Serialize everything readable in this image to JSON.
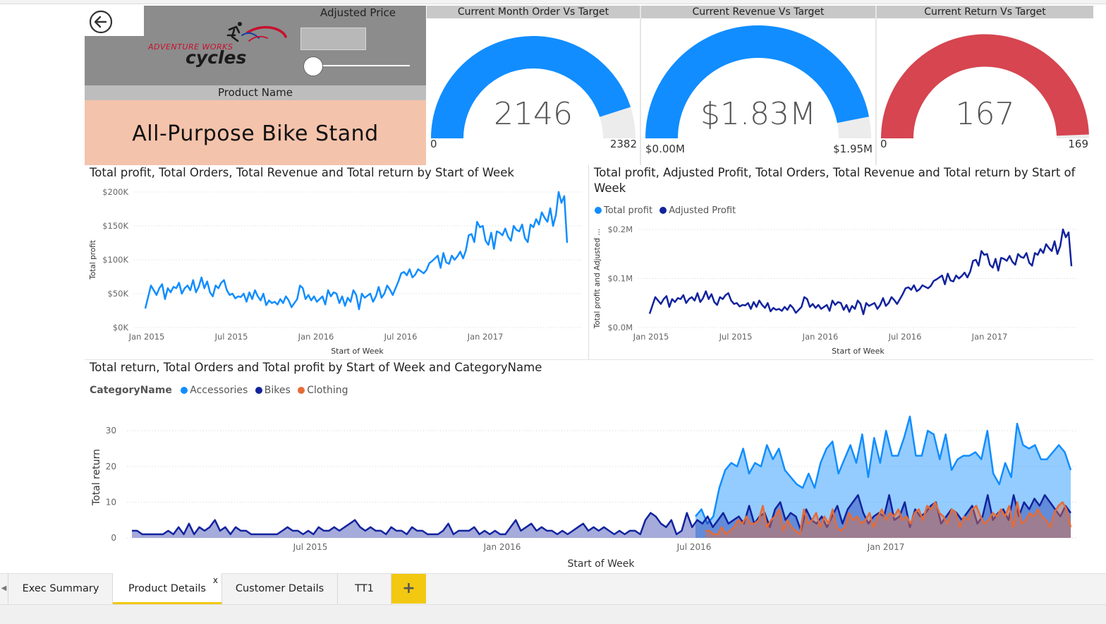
{
  "header": {
    "back_icon": "arrow-left-circle-icon",
    "logo_text_top": "ADVENTURE WORKS",
    "logo_text_bottom": "cycles",
    "adjusted_price_label": "Adjusted Price",
    "adjusted_price_value": "",
    "slider_value": 0,
    "product_name_label": "Product Name",
    "product_name_value": "All-Purpose Bike Stand"
  },
  "gauges": [
    {
      "title": "Current Month Order Vs Target",
      "value_label": "2146",
      "value": 2146,
      "min_label": "0",
      "max_label": "2382",
      "min": 0,
      "max": 2382,
      "color": "#118DFF"
    },
    {
      "title": "Current Revenue Vs Target",
      "value_label": "$1.83M",
      "value": 1.83,
      "min_label": "$0.00M",
      "max_label": "$1.95M",
      "min": 0,
      "max": 1.95,
      "color": "#118DFF"
    },
    {
      "title": "Current Return Vs Target",
      "value_label": "167",
      "value": 167,
      "min_label": "0",
      "max_label": "169",
      "min": 0,
      "max": 169,
      "color": "#D64550"
    }
  ],
  "chart_data": [
    {
      "type": "line",
      "title": "Total profit, Total Orders, Total Revenue and Total return by Start of Week",
      "xlabel": "Start of Week",
      "ylabel": "Total profit",
      "x_ticks": [
        "Jan 2015",
        "Jul 2015",
        "Jan 2016",
        "Jul 2016",
        "Jan 2017"
      ],
      "y_ticks": [
        "$0K",
        "$50K",
        "$100K",
        "$150K",
        "$200K"
      ],
      "ylim": [
        0,
        200000
      ],
      "grid": true,
      "series": [
        {
          "color": "#118DFF",
          "values": [
            28000,
            45000,
            62000,
            55000,
            48000,
            58000,
            64000,
            42000,
            58000,
            52000,
            60000,
            58000,
            66000,
            50000,
            58000,
            62000,
            55000,
            70000,
            52000,
            60000,
            74000,
            58000,
            68000,
            52000,
            46000,
            62000,
            58000,
            66000,
            70000,
            55000,
            48000,
            50000,
            43000,
            46000,
            45000,
            50000,
            38000,
            52000,
            42000,
            55000,
            46000,
            40000,
            50000,
            33000,
            40000,
            36000,
            38000,
            34000,
            42000,
            36000,
            46000,
            40000,
            30000,
            36000,
            42000,
            62000,
            58000,
            42000,
            48000,
            40000,
            46000,
            38000,
            42000,
            46000,
            34000,
            55000,
            46000,
            52000,
            50000,
            36000,
            46000,
            32000,
            44000,
            38000,
            55000,
            48000,
            27000,
            50000,
            44000,
            47000,
            50000,
            38000,
            46000,
            60000,
            44000,
            50000,
            62000,
            56000,
            48000,
            58000,
            68000,
            80000,
            82000,
            77000,
            86000,
            74000,
            78000,
            86000,
            83000,
            80000,
            85000,
            95000,
            98000,
            102000,
            106000,
            88000,
            110000,
            96000,
            94000,
            106000,
            100000,
            105000,
            112000,
            102000,
            114000,
            136000,
            138000,
            126000,
            156000,
            148000,
            150000,
            128000,
            122000,
            140000,
            116000,
            142000,
            140000,
            136000,
            146000,
            134000,
            128000,
            150000,
            144000,
            142000,
            152000,
            132000,
            126000,
            152000,
            148000,
            160000,
            152000,
            170000,
            162000,
            156000,
            176000,
            150000,
            166000,
            200000,
            184000,
            194000,
            125000
          ]
        }
      ]
    },
    {
      "type": "line",
      "title": "Total profit, Adjusted Profit, Total Orders, Total Revenue and Total return by Start of Week",
      "xlabel": "Start of Week",
      "ylabel": "Total profit and Adjusted ...",
      "legend": [
        "Total profit",
        "Adjusted Profit"
      ],
      "legend_colors": [
        "#118DFF",
        "#12239E"
      ],
      "x_ticks": [
        "Jan 2015",
        "Jul 2015",
        "Jan 2016",
        "Jul 2016",
        "Jan 2017"
      ],
      "y_ticks": [
        "$0.0M",
        "$0.1M",
        "$0.2M"
      ],
      "ylim": [
        0,
        0.2
      ],
      "grid": true,
      "series": [
        {
          "name": "Total profit",
          "color": "#118DFF",
          "values": [
            0.028,
            0.045,
            0.062,
            0.055,
            0.048,
            0.058,
            0.064,
            0.042,
            0.058,
            0.052,
            0.06,
            0.058,
            0.066,
            0.05,
            0.058,
            0.062,
            0.055,
            0.07,
            0.052,
            0.06,
            0.074,
            0.058,
            0.068,
            0.052,
            0.046,
            0.062,
            0.058,
            0.066,
            0.07,
            0.055,
            0.048,
            0.05,
            0.043,
            0.046,
            0.045,
            0.05,
            0.038,
            0.052,
            0.042,
            0.055,
            0.046,
            0.04,
            0.05,
            0.033,
            0.04,
            0.036,
            0.038,
            0.034,
            0.042,
            0.036,
            0.046,
            0.04,
            0.03,
            0.036,
            0.042,
            0.062,
            0.058,
            0.042,
            0.048,
            0.04,
            0.046,
            0.038,
            0.042,
            0.046,
            0.034,
            0.055,
            0.046,
            0.052,
            0.05,
            0.036,
            0.046,
            0.032,
            0.044,
            0.038,
            0.055,
            0.048,
            0.027,
            0.05,
            0.044,
            0.047,
            0.05,
            0.038,
            0.046,
            0.06,
            0.044,
            0.05,
            0.062,
            0.056,
            0.048,
            0.058,
            0.068,
            0.08,
            0.082,
            0.077,
            0.086,
            0.074,
            0.078,
            0.086,
            0.083,
            0.08,
            0.085,
            0.095,
            0.098,
            0.102,
            0.106,
            0.088,
            0.11,
            0.096,
            0.094,
            0.106,
            0.1,
            0.105,
            0.112,
            0.102,
            0.114,
            0.136,
            0.138,
            0.126,
            0.156,
            0.148,
            0.15,
            0.128,
            0.122,
            0.14,
            0.116,
            0.142,
            0.14,
            0.136,
            0.146,
            0.134,
            0.128,
            0.15,
            0.144,
            0.142,
            0.152,
            0.132,
            0.126,
            0.152,
            0.148,
            0.16,
            0.152,
            0.17,
            0.162,
            0.156,
            0.176,
            0.15,
            0.166,
            0.2,
            0.184,
            0.194,
            0.125
          ]
        },
        {
          "name": "Adjusted Profit",
          "color": "#12239E",
          "values": [
            0.028,
            0.045,
            0.062,
            0.055,
            0.048,
            0.058,
            0.064,
            0.042,
            0.058,
            0.052,
            0.06,
            0.058,
            0.066,
            0.05,
            0.058,
            0.062,
            0.055,
            0.07,
            0.052,
            0.06,
            0.074,
            0.058,
            0.068,
            0.052,
            0.046,
            0.062,
            0.058,
            0.066,
            0.07,
            0.055,
            0.048,
            0.05,
            0.043,
            0.046,
            0.045,
            0.05,
            0.038,
            0.052,
            0.042,
            0.055,
            0.046,
            0.04,
            0.05,
            0.033,
            0.04,
            0.036,
            0.038,
            0.034,
            0.042,
            0.036,
            0.046,
            0.04,
            0.03,
            0.036,
            0.042,
            0.062,
            0.058,
            0.042,
            0.048,
            0.04,
            0.046,
            0.038,
            0.042,
            0.046,
            0.034,
            0.055,
            0.046,
            0.052,
            0.05,
            0.036,
            0.046,
            0.032,
            0.044,
            0.038,
            0.055,
            0.048,
            0.027,
            0.05,
            0.044,
            0.047,
            0.05,
            0.038,
            0.046,
            0.06,
            0.044,
            0.05,
            0.062,
            0.056,
            0.048,
            0.058,
            0.068,
            0.08,
            0.082,
            0.077,
            0.086,
            0.074,
            0.078,
            0.086,
            0.083,
            0.08,
            0.085,
            0.095,
            0.098,
            0.102,
            0.106,
            0.088,
            0.11,
            0.096,
            0.094,
            0.106,
            0.1,
            0.105,
            0.112,
            0.102,
            0.114,
            0.136,
            0.138,
            0.126,
            0.156,
            0.148,
            0.15,
            0.128,
            0.122,
            0.14,
            0.116,
            0.142,
            0.14,
            0.136,
            0.146,
            0.134,
            0.128,
            0.15,
            0.144,
            0.142,
            0.152,
            0.132,
            0.126,
            0.152,
            0.148,
            0.16,
            0.152,
            0.17,
            0.162,
            0.156,
            0.176,
            0.15,
            0.166,
            0.2,
            0.184,
            0.194,
            0.125
          ]
        }
      ]
    },
    {
      "type": "area",
      "title": "Total return, Total Orders and Total profit by Start of Week and CategoryName",
      "xlabel": "Start of Week",
      "ylabel": "Total return",
      "legend_title": "CategoryName",
      "legend": [
        "Accessories",
        "Bikes",
        "Clothing"
      ],
      "x_ticks": [
        "Jul 2015",
        "Jan 2016",
        "Jul 2016",
        "Jan 2017"
      ],
      "y_ticks": [
        "0",
        "10",
        "20",
        "30"
      ],
      "ylim": [
        0,
        34
      ],
      "grid": true,
      "series": [
        {
          "name": "Accessories",
          "color": "#118DFF",
          "values": [
            6,
            8,
            4,
            6,
            14,
            19,
            21,
            20,
            25,
            18,
            21,
            20,
            26,
            22,
            25,
            19,
            17,
            15,
            14,
            18,
            14,
            21,
            25,
            27,
            18,
            22,
            26,
            21,
            29,
            17,
            28,
            21,
            30,
            23,
            23,
            28,
            34,
            23,
            23,
            30,
            29,
            22,
            29,
            19,
            22,
            23,
            23,
            24,
            22,
            30,
            18,
            15,
            21,
            17,
            32,
            26,
            25,
            26,
            22,
            22,
            24,
            26,
            24,
            19
          ]
        },
        {
          "name": "Bikes",
          "color": "#12239E",
          "values": [
            2,
            2,
            1,
            1,
            1,
            1,
            1,
            2,
            1,
            3,
            1,
            4,
            1,
            3,
            2,
            3,
            5,
            2,
            3,
            1,
            3,
            2,
            2,
            1,
            1,
            1,
            1,
            1,
            1,
            2,
            3,
            2,
            2,
            1,
            2,
            1,
            3,
            2,
            2,
            3,
            2,
            3,
            4,
            5,
            3,
            2,
            3,
            2,
            2,
            1,
            3,
            2,
            2,
            1,
            3,
            2,
            2,
            1,
            1,
            1,
            2,
            4,
            1,
            2,
            2,
            2,
            3,
            1,
            2,
            1,
            2,
            1,
            1,
            3,
            5,
            2,
            3,
            4,
            2,
            3,
            2,
            2,
            1,
            2,
            1,
            2,
            3,
            4,
            2,
            3,
            2,
            3,
            2,
            1,
            2,
            1,
            2,
            2,
            1,
            5,
            7,
            6,
            4,
            3,
            5,
            1,
            2,
            7,
            3,
            5,
            4,
            6,
            3,
            5,
            7,
            4,
            5,
            6,
            4,
            9,
            4,
            6,
            7,
            3,
            8,
            10,
            5,
            7,
            6,
            2,
            8,
            5,
            4,
            6,
            3,
            6,
            9,
            4,
            8,
            10,
            12,
            7,
            4,
            6,
            7,
            6,
            12,
            5,
            6,
            10,
            3,
            8,
            6,
            7,
            9,
            10,
            4,
            6,
            8,
            7,
            5,
            7,
            9,
            4,
            6,
            12,
            5,
            7,
            8,
            5,
            12,
            6,
            10,
            8,
            11,
            9,
            12,
            10,
            8,
            6,
            9,
            7
          ]
        },
        {
          "name": "Clothing",
          "color": "#E66C37",
          "values": [
            2,
            2,
            1,
            1,
            3,
            1,
            2,
            3,
            5,
            4,
            6,
            4,
            4,
            5,
            9,
            3,
            5,
            6,
            8,
            2,
            5,
            3,
            2,
            1,
            8,
            4,
            5,
            7,
            3,
            6,
            4,
            8,
            3,
            2,
            3,
            7,
            5,
            6,
            4,
            5,
            7,
            3,
            6,
            8,
            5,
            7,
            6,
            8,
            5,
            6,
            4,
            7,
            8,
            5,
            9,
            8,
            10,
            7,
            6,
            4,
            8,
            7,
            3,
            6,
            5,
            8,
            9,
            6,
            4,
            5,
            7,
            6,
            8,
            6,
            9,
            3,
            10,
            4,
            5,
            7,
            6,
            8,
            6,
            5,
            3,
            7,
            9,
            10,
            8,
            3
          ]
        }
      ]
    }
  ],
  "tabs": {
    "items": [
      {
        "label": "Exec Summary",
        "active": false
      },
      {
        "label": "Product Details",
        "active": true,
        "close": "x"
      },
      {
        "label": "Customer Details",
        "active": false
      },
      {
        "label": "TT1",
        "active": false
      }
    ],
    "add_label": "+",
    "add_color": "#F2C811",
    "scroll_icon": "chevron-left-icon"
  },
  "colors": {
    "accent_blue": "#118DFF",
    "dark_blue": "#12239E",
    "orange": "#E66C37",
    "red": "#D64550",
    "product_bg": "#F4C3AB",
    "tab_accent": "#F2C811"
  }
}
